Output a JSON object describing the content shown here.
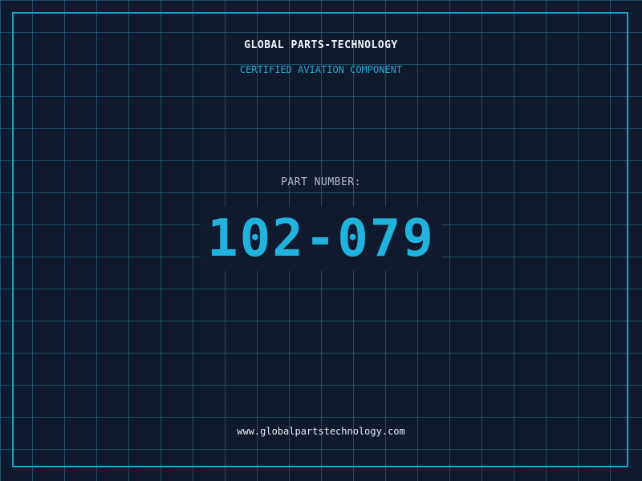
{
  "header": {
    "company": "GLOBAL PARTS-TECHNOLOGY",
    "tagline": "CERTIFIED AVIATION COMPONENT"
  },
  "part": {
    "label": "PART NUMBER:",
    "number": "102-079"
  },
  "footer": {
    "website": "www.globalpartstechnology.com"
  },
  "colors": {
    "background": "#0f1a2e",
    "grid": "#28789a",
    "frame": "#1fa3c9",
    "accent": "#21b3dc"
  }
}
